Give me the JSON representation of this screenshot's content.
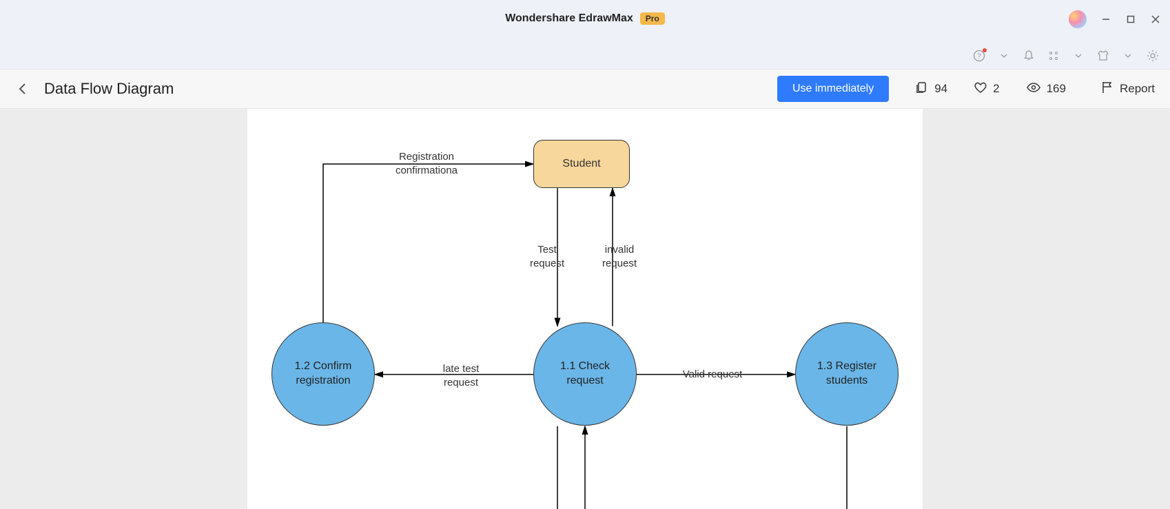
{
  "titlebar": {
    "app_name": "Wondershare EdrawMax",
    "badge": "Pro"
  },
  "subheader": {
    "page_title": "Data Flow Diagram",
    "primary_button": "Use immediately",
    "stats": {
      "copies": "94",
      "likes": "2",
      "views": "169"
    },
    "report": "Report"
  },
  "diagram": {
    "entity_student": "Student",
    "process_12_line1": "1.2 Confirm",
    "process_12_line2": "registration",
    "process_11_line1": "1.1 Check",
    "process_11_line2": "request",
    "process_13_line1": "1.3 Register",
    "process_13_line2": "students",
    "label_reg_conf_1": "Registration",
    "label_reg_conf_2": "confirmationa",
    "label_test_req_1": "Test",
    "label_test_req_2": "request",
    "label_invalid_req_1": "invalid",
    "label_invalid_req_2": "request",
    "label_late_test_1": "late test",
    "label_late_test_2": "request",
    "label_valid_req": "Valid request"
  }
}
